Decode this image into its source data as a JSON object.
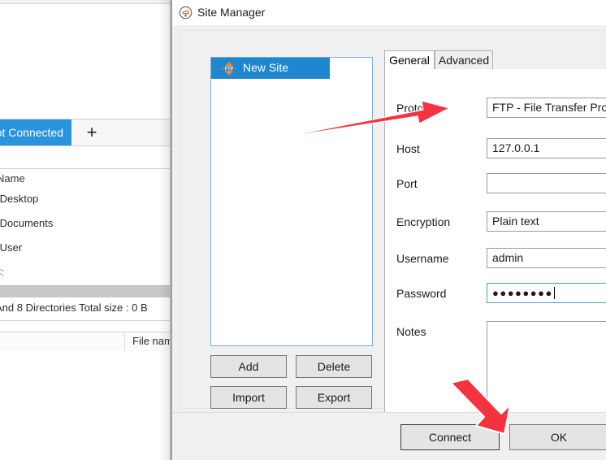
{
  "background_window": {
    "tab_label": "Not Connected",
    "add_tab_icon": "plus-icon",
    "column_header": "Name",
    "files": [
      {
        "name": "~Desktop"
      },
      {
        "name": "~Documents"
      },
      {
        "name": "~User"
      },
      {
        "name": "C:"
      }
    ],
    "status_text": "And 8 Directories Total size : 0 B",
    "lower_column_header": "File name",
    "tab_active_color": "#2a93de"
  },
  "dialog": {
    "title": "Site Manager",
    "title_icon": "site-manager-icon",
    "tree": {
      "items": [
        {
          "label": "New Site",
          "icon": "ftp-site-icon",
          "selected": true
        }
      ],
      "selection_color": "#1e87cf"
    },
    "side_buttons": [
      {
        "label": "Add"
      },
      {
        "label": "Delete"
      },
      {
        "label": "Import"
      },
      {
        "label": "Export"
      }
    ],
    "tabs": [
      {
        "label": "General",
        "active": true
      },
      {
        "label": "Advanced",
        "active": false
      }
    ],
    "form": {
      "fields": [
        {
          "label": "Protocol",
          "value": "FTP - File Transfer Protocol",
          "type": "select",
          "focused": false
        },
        {
          "label": "Host",
          "value": "127.0.0.1",
          "type": "text",
          "focused": false
        },
        {
          "label": "Port",
          "value": "",
          "type": "text",
          "focused": false
        },
        {
          "label": "Encryption",
          "value": "Plain text",
          "type": "select",
          "focused": false
        },
        {
          "label": "Username",
          "value": "admin",
          "type": "text",
          "focused": false
        },
        {
          "label": "Password",
          "value": "●●●●●●●●",
          "type": "password",
          "focused": true
        },
        {
          "label": "Notes",
          "value": "",
          "type": "textarea",
          "focused": false
        }
      ]
    },
    "footer_buttons": [
      {
        "label": "Connect",
        "is_default": true
      },
      {
        "label": "OK",
        "is_default": false
      }
    ]
  },
  "annotations": {
    "arrow_color": "#f5333f",
    "arrows": [
      {
        "name": "host-field-arrow",
        "points_to": "Host"
      },
      {
        "name": "connect-button-arrow",
        "points_to": "Connect"
      }
    ]
  }
}
